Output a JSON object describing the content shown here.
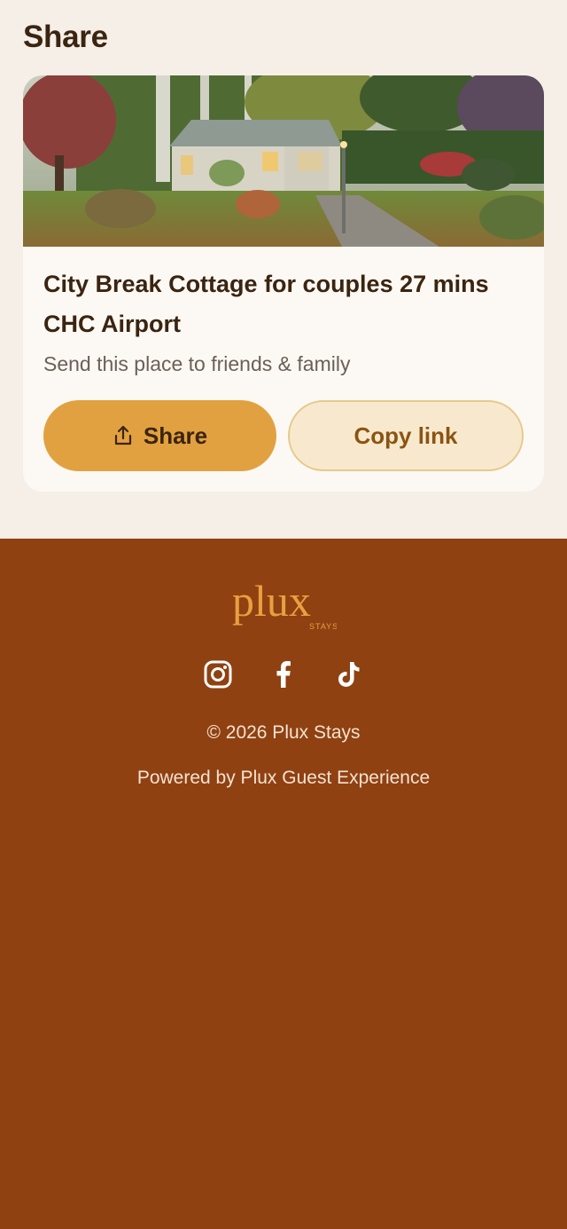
{
  "section": {
    "title": "Share"
  },
  "listing": {
    "title": "City Break Cottage for couples 27 mins CHC Airport",
    "subtitle": "Send this place to friends & family",
    "photo_alt": "Cottage with garden"
  },
  "actions": {
    "share_label": "Share",
    "copy_label": "Copy link"
  },
  "footer": {
    "logo_text": "plux",
    "logo_subtext": "STAYS",
    "social_icons": [
      "instagram-icon",
      "facebook-icon",
      "tiktok-icon"
    ],
    "copyright": "© 2026 Plux Stays",
    "powered_by": "Powered by Plux Guest Experience"
  },
  "colors": {
    "page_bg": "#f5efe8",
    "card_bg": "#fcf9f4",
    "primary_button": "#e2a140",
    "secondary_button": "#f8e9ce",
    "footer_bg": "#8f4112",
    "logo": "#e8a040",
    "heading_text": "#3b2410"
  }
}
